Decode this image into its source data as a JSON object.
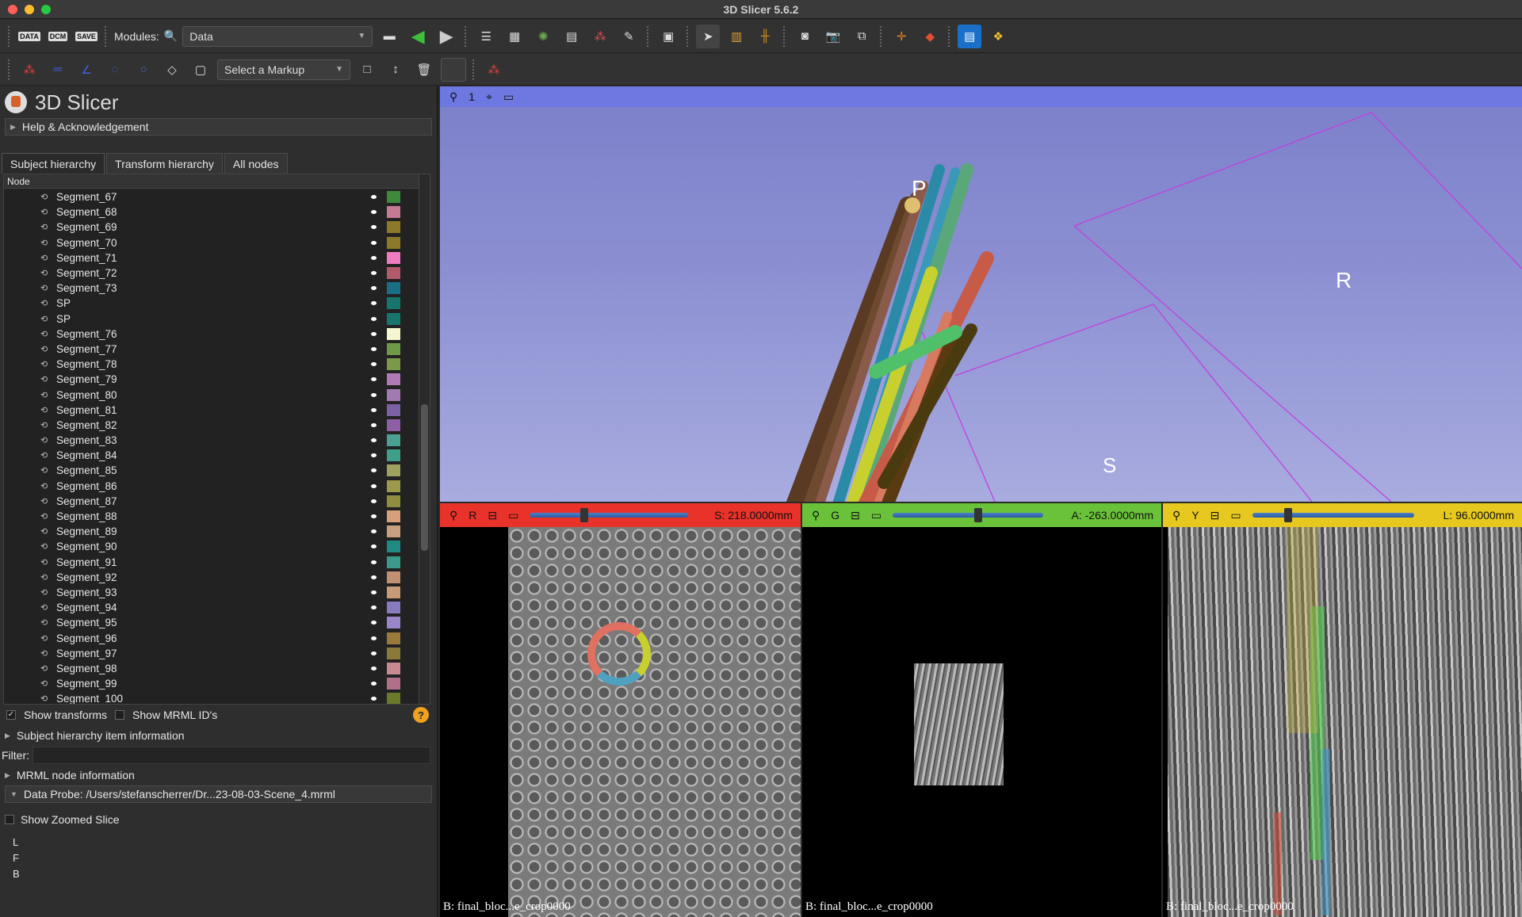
{
  "window": {
    "title": "3D Slicer 5.6.2"
  },
  "toolbar": {
    "data_btn": "DATA",
    "dcm_btn": "DCM",
    "save_btn": "SAVE",
    "modules_label": "Modules:",
    "module_select": "Data",
    "markup_select": "Select a Markup"
  },
  "panel": {
    "app_name": "3D Slicer",
    "help": "Help & Acknowledgement",
    "tabs": [
      "Subject hierarchy",
      "Transform hierarchy",
      "All nodes"
    ],
    "tree_header": "Node",
    "nodes": [
      {
        "label": "Segment_67",
        "color": "#3f8a3a"
      },
      {
        "label": "Segment_68",
        "color": "#c47a93"
      },
      {
        "label": "Segment_69",
        "color": "#8c7a2a"
      },
      {
        "label": "Segment_70",
        "color": "#8c7a2a"
      },
      {
        "label": "Segment_71",
        "color": "#f07cc0"
      },
      {
        "label": "Segment_72",
        "color": "#b05a6a"
      },
      {
        "label": "Segment_73",
        "color": "#1a6e86"
      },
      {
        "label": "SP",
        "color": "#16766e"
      },
      {
        "label": "SP",
        "color": "#16766e"
      },
      {
        "label": "Segment_76",
        "color": "#f5f5d0"
      },
      {
        "label": "Segment_77",
        "color": "#6e9a48"
      },
      {
        "label": "Segment_78",
        "color": "#7a9a4a"
      },
      {
        "label": "Segment_79",
        "color": "#b07ab5"
      },
      {
        "label": "Segment_80",
        "color": "#a07ab0"
      },
      {
        "label": "Segment_81",
        "color": "#7a62a5"
      },
      {
        "label": "Segment_82",
        "color": "#8e5ea6"
      },
      {
        "label": "Segment_83",
        "color": "#4aa092"
      },
      {
        "label": "Segment_84",
        "color": "#3ea08a"
      },
      {
        "label": "Segment_85",
        "color": "#a0a060"
      },
      {
        "label": "Segment_86",
        "color": "#9a9a4a"
      },
      {
        "label": "Segment_87",
        "color": "#8e8e3e"
      },
      {
        "label": "Segment_88",
        "color": "#d8a07a"
      },
      {
        "label": "Segment_89",
        "color": "#c8a080"
      },
      {
        "label": "Segment_90",
        "color": "#1e8a82"
      },
      {
        "label": "Segment_91",
        "color": "#3a9a8a"
      },
      {
        "label": "Segment_92",
        "color": "#c09070"
      },
      {
        "label": "Segment_93",
        "color": "#c89a76"
      },
      {
        "label": "Segment_94",
        "color": "#8a7ac0"
      },
      {
        "label": "Segment_95",
        "color": "#9a86c8"
      },
      {
        "label": "Segment_96",
        "color": "#9a7a3a"
      },
      {
        "label": "Segment_97",
        "color": "#8a7a3a"
      },
      {
        "label": "Segment_98",
        "color": "#c88a90"
      },
      {
        "label": "Segment_99",
        "color": "#b0708a"
      },
      {
        "label": "Segment_100",
        "color": "#6a7a2a"
      }
    ],
    "show_transforms": "Show transforms",
    "show_mrml_ids": "Show MRML ID's",
    "sh_item_info": "Subject hierarchy item information",
    "filter_label": "Filter:",
    "mrml_info": "MRML node information",
    "data_probe": "Data Probe: /Users/stefanscherrer/Dr...23-08-03-Scene_4.mrml",
    "show_zoomed": "Show Zoomed Slice",
    "probe_labels": [
      "L",
      "F",
      "B"
    ]
  },
  "view3d": {
    "number": "1",
    "labels": {
      "p": "P",
      "r": "R",
      "s": "S"
    }
  },
  "slices": [
    {
      "letter": "R",
      "value": "S: 218.0000mm",
      "bar": "#e8322a",
      "caption": "B: final_bloc...e_crop0000",
      "slider_pos": 0.32
    },
    {
      "letter": "G",
      "value": "A: -263.0000mm",
      "bar": "#6ac23a",
      "caption": "B: final_bloc...e_crop0000",
      "slider_pos": 0.54
    },
    {
      "letter": "Y",
      "value": "L: 96.0000mm",
      "bar": "#e6c81e",
      "caption": "B: final_bloc...e_crop0000",
      "slider_pos": 0.2
    }
  ]
}
